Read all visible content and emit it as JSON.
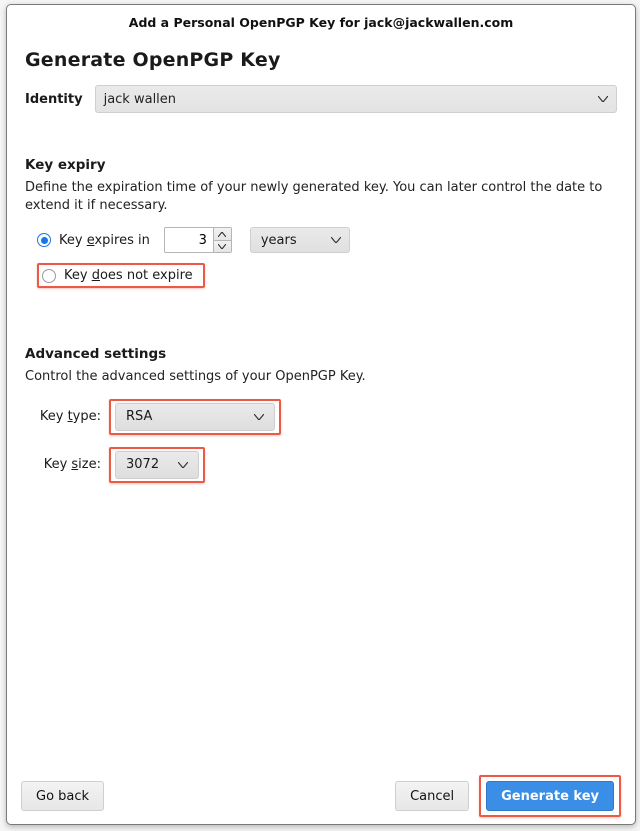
{
  "window": {
    "title": "Add a Personal OpenPGP Key for jack@jackwallen.com"
  },
  "page": {
    "heading": "Generate OpenPGP Key"
  },
  "identity": {
    "label": "Identity",
    "value": "jack wallen"
  },
  "expiry": {
    "section_title": "Key expiry",
    "description": "Define the expiration time of your newly generated key. You can later control the date to extend it if necessary.",
    "option_expires_prefix": "Key ",
    "option_expires_underline": "e",
    "option_expires_suffix": "xpires in",
    "option_noexpire_prefix": "Key ",
    "option_noexpire_underline": "d",
    "option_noexpire_suffix": "oes not expire",
    "value": "3",
    "unit": "years",
    "selected": "expires"
  },
  "advanced": {
    "section_title": "Advanced settings",
    "description": "Control the advanced settings of your OpenPGP Key.",
    "type_label_prefix": "Key ",
    "type_label_underline": "t",
    "type_label_suffix": "ype:",
    "type_value": "RSA",
    "size_label_prefix": "Key ",
    "size_label_underline": "s",
    "size_label_suffix": "ize:",
    "size_value": "3072"
  },
  "footer": {
    "go_back": "Go back",
    "cancel": "Cancel",
    "generate": "Generate key"
  }
}
